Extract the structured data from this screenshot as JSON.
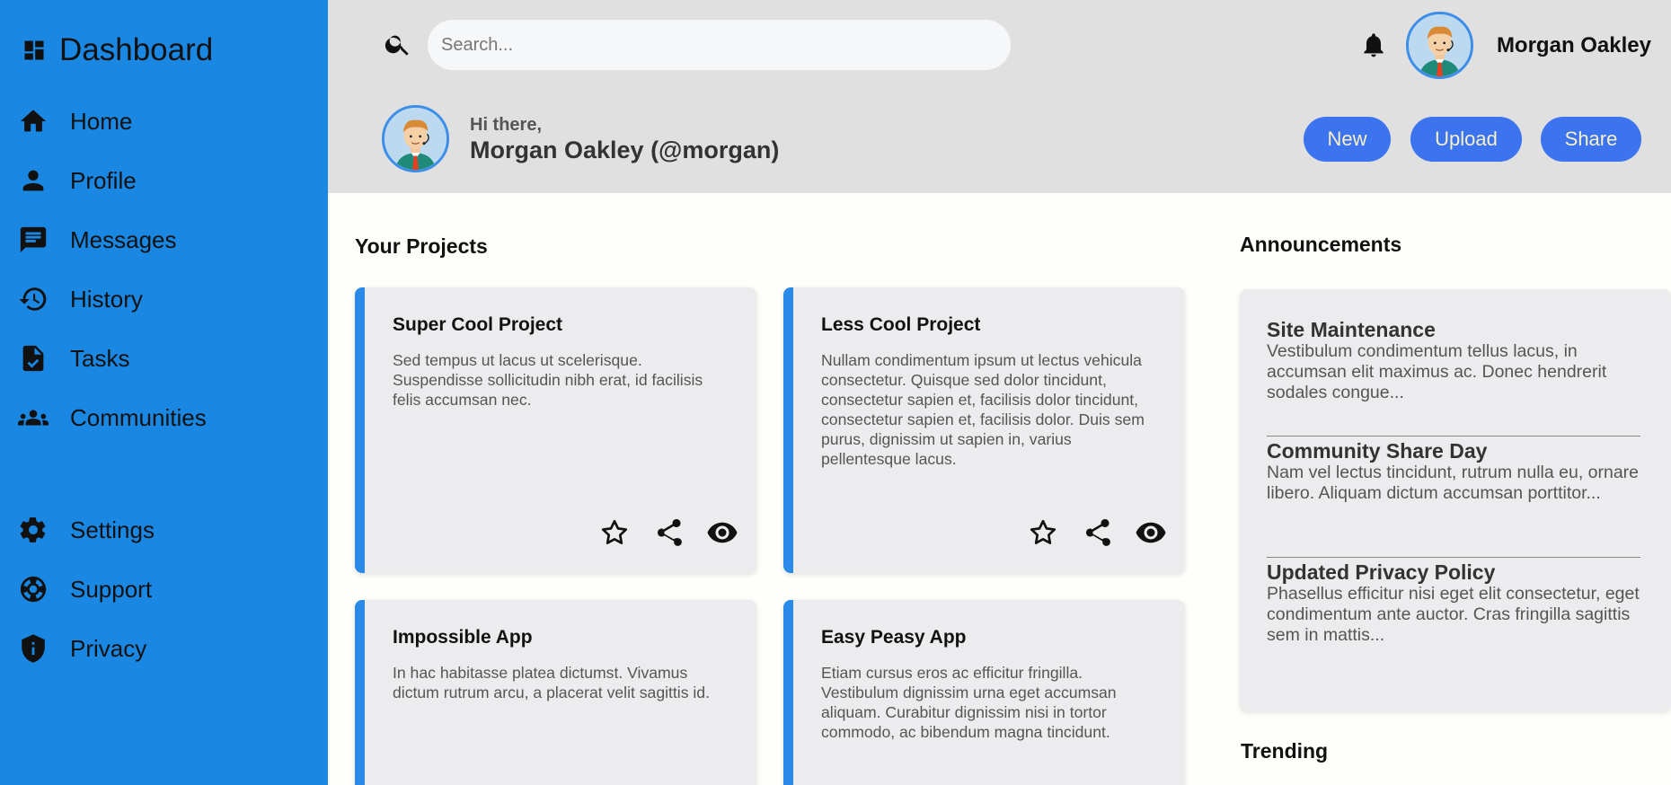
{
  "sidebar": {
    "brand": {
      "label": "Dashboard",
      "icon": "dashboard-icon"
    },
    "items": [
      {
        "label": "Home",
        "icon": "home-icon"
      },
      {
        "label": "Profile",
        "icon": "person-icon"
      },
      {
        "label": "Messages",
        "icon": "message-icon"
      },
      {
        "label": "History",
        "icon": "history-icon"
      },
      {
        "label": "Tasks",
        "icon": "task-icon"
      },
      {
        "label": "Communities",
        "icon": "groups-icon"
      },
      {
        "label": "Settings",
        "icon": "gear-icon"
      },
      {
        "label": "Support",
        "icon": "lifebuoy-icon"
      },
      {
        "label": "Privacy",
        "icon": "shield-icon"
      }
    ]
  },
  "header": {
    "search_placeholder": "Search...",
    "user_name": "Morgan Oakley",
    "greeting": "Hi there,",
    "user_handle": "Morgan Oakley (@morgan)",
    "buttons": {
      "new": "New",
      "upload": "Upload",
      "share": "Share"
    }
  },
  "projects": {
    "title": "Your Projects",
    "items": [
      {
        "title": "Super Cool Project",
        "body": "Sed tempus ut lacus ut scelerisque. Suspendisse sollicitudin nibh erat, id facilisis felis accumsan nec."
      },
      {
        "title": "Less Cool Project",
        "body": "Nullam condimentum ipsum ut lectus vehicula consectetur. Quisque sed dolor tincidunt, consectetur sapien et, facilisis dolor tincidunt, consectetur sapien et, facilisis dolor. Duis sem purus, dignissim ut sapien in, varius pellentesque lacus."
      },
      {
        "title": "Impossible App",
        "body": "In hac habitasse platea dictumst. Vivamus dictum rutrum arcu, a placerat velit sagittis id."
      },
      {
        "title": "Easy Peasy App",
        "body": "Etiam cursus eros ac efficitur fringilla. Vestibulum dignissim urna eget accumsan aliquam. Curabitur dignissim nisi in tortor commodo, ac bibendum magna tincidunt."
      }
    ]
  },
  "announcements": {
    "title": "Announcements",
    "items": [
      {
        "title": "Site Maintenance",
        "body": "Vestibulum condimentum tellus lacus, in accumsan elit maximus ac. Donec hendrerit sodales congue..."
      },
      {
        "title": "Community Share Day",
        "body": "Nam vel lectus tincidunt, rutrum nulla eu, ornare libero. Aliquam dictum accumsan porttitor..."
      },
      {
        "title": "Updated Privacy Policy",
        "body": "Phasellus efficitur nisi eget elit consectetur, eget condimentum ante auctor. Cras fringilla sagittis sem in mattis..."
      }
    ]
  },
  "trending": {
    "title": "Trending"
  },
  "colors": {
    "sidebar": "#1a87e2",
    "accent_button": "#3c73ee",
    "card_bar": "#2b8ae8",
    "header_bg": "#e0e0e0"
  }
}
